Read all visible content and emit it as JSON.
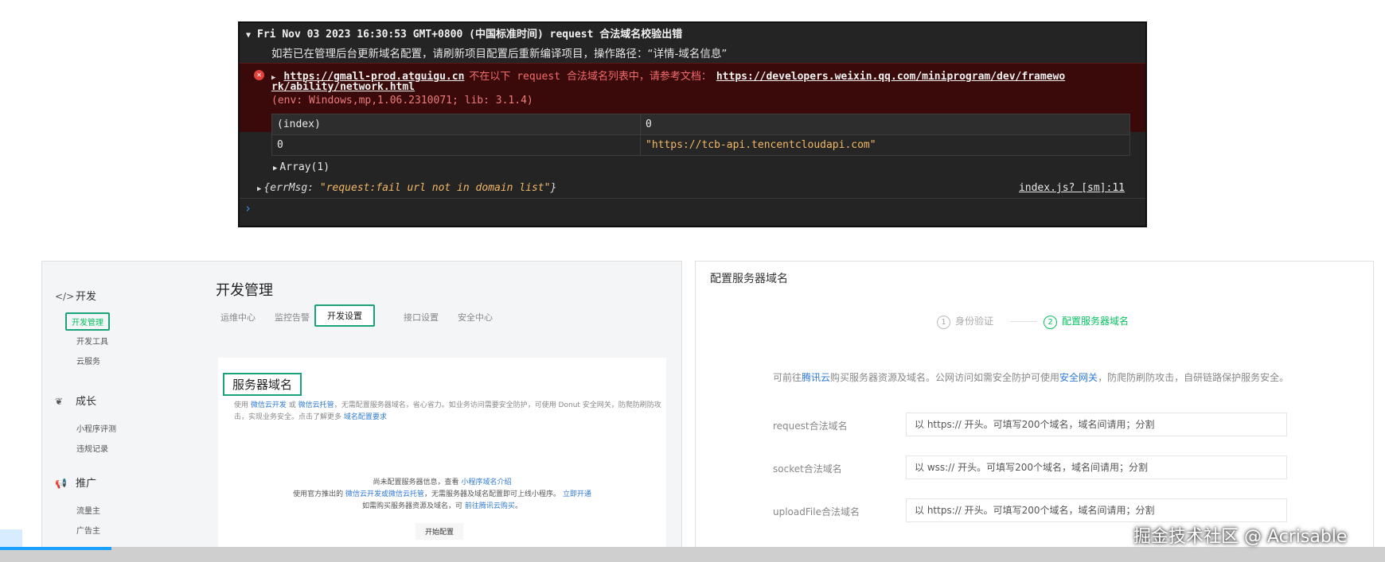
{
  "console": {
    "header": "Fri Nov 03 2023 16:30:53 GMT+0800 (中国标准时间) request 合法域名校验出错",
    "message": "如若已在管理后台更新域名配置，请刷新项目配置后重新编译项目，操作路径：“详情-域名信息”",
    "error": {
      "url": "https://gmall-prod.atguigu.cn",
      "text": "不在以下 request 合法域名列表中，请参考文档：",
      "doc_url_1": "https://developers.weixin.qq.com/miniprogram/dev/framewo",
      "doc_url_2": "rk/ability/network.html",
      "env": "(env: Windows,mp,1.06.2310071; lib: 3.1.4)"
    },
    "table": {
      "header": [
        "(index)",
        "0"
      ],
      "row": [
        "0",
        "\"https://tcb-api.tencentcloudapi.com\""
      ]
    },
    "array_label": "Array(1)",
    "errmsg_key": "{errMsg:",
    "errmsg_value": "\"request:fail url not in domain list\"",
    "errmsg_close": "}",
    "source": "index.js? [sm]:11"
  },
  "left_panel": {
    "sidebar": {
      "sections": [
        {
          "label": "开发",
          "icon": "</>"
        },
        {
          "label": "成长",
          "icon": "❦"
        },
        {
          "label": "推广",
          "icon": "📢"
        }
      ],
      "items": [
        "开发管理",
        "开发工具",
        "云服务",
        "小程序评测",
        "违规记录",
        "流量主",
        "广告主"
      ]
    },
    "title": "开发管理",
    "tabs": [
      "运维中心",
      "监控告警",
      "开发设置",
      "接口设置",
      "安全中心"
    ],
    "card": {
      "title": "服务器域名",
      "desc_1": "使用",
      "desc_link_1": "微信云开发",
      "desc_2": "或",
      "desc_link_2": "微信云托管",
      "desc_3": "，无需配置服务器域名，省心省力。如业务访问需要安全防护，可使用 Donut 安全网关",
      "desc_4": "，防爬防刷防攻击，实现业务安全。点击了解更多",
      "desc_link_3": "域名配置要求",
      "empty_1": "尚未配置服务器信息，查看",
      "empty_link_1": "小程序域名介绍",
      "empty_2": "使用官方推出的",
      "empty_link_2": "微信云开发或微信云托管",
      "empty_3": "，无需服务器及域名配置即可上线小程序。",
      "empty_link_3": "立即开通",
      "empty_4": "如需购买服务器资源及域名，可",
      "empty_link_4": "前往腾讯云购买",
      "empty_5": "。",
      "button": "开始配置"
    }
  },
  "right_panel": {
    "title": "配置服务器域名",
    "step1": {
      "num": "1",
      "label": "身份验证"
    },
    "step2": {
      "num": "2",
      "label": "配置服务器域名"
    },
    "desc_1": "可前往",
    "desc_link_1": "腾讯云",
    "desc_2": "购买服务器资源及域名。公网访问如需安全防护可使用",
    "desc_link_2": "安全网关",
    "desc_3": "，防爬防刷防攻击，自研链路保护服务安全。",
    "rows": [
      {
        "label": "request合法域名",
        "placeholder": "以 https:// 开头。可填写200个域名，域名间请用；分割"
      },
      {
        "label": "socket合法域名",
        "placeholder": "以 wss:// 开头。可填写200个域名，域名间请用；分割"
      },
      {
        "label": "uploadFile合法域名",
        "placeholder": "以 https:// 开头。可填写200个域名，域名间请用；分割"
      }
    ]
  },
  "watermark": "掘金技术社区 @ Acrisable"
}
